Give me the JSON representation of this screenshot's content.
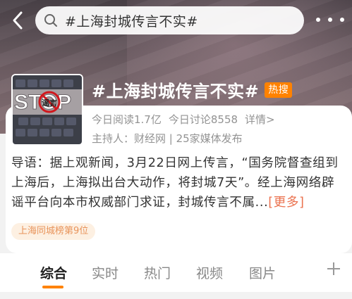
{
  "header": {
    "search_text": "#上海封城传言不实#"
  },
  "topic": {
    "title": "#上海封城传言不实#",
    "hot_badge": "热搜",
    "thumbnail_text": "STOP",
    "thumbnail_key_text": "谣言",
    "read_count": "今日阅读1.7亿",
    "discuss_count": "今日讨论8558",
    "detail_link": "详情>",
    "host_line": "主持人：财经网 | 25家媒体发布",
    "intro_text": "导语：据上观新闻，3月22日网上传言，“国务院督查组到上海后，上海拟出台大动作，将封城7天”。经上海网络辟谣平台向本市权威部门求证，封城传言不属...",
    "intro_more": "[更多]",
    "rank_badge": "上海同城榜第9位"
  },
  "tabs": [
    {
      "label": "综合"
    },
    {
      "label": "实时"
    },
    {
      "label": "热门"
    },
    {
      "label": "视频"
    },
    {
      "label": "图片"
    }
  ],
  "colors": {
    "accent": "#ff8200",
    "link": "#eb7350",
    "muted_text": "#939393"
  }
}
